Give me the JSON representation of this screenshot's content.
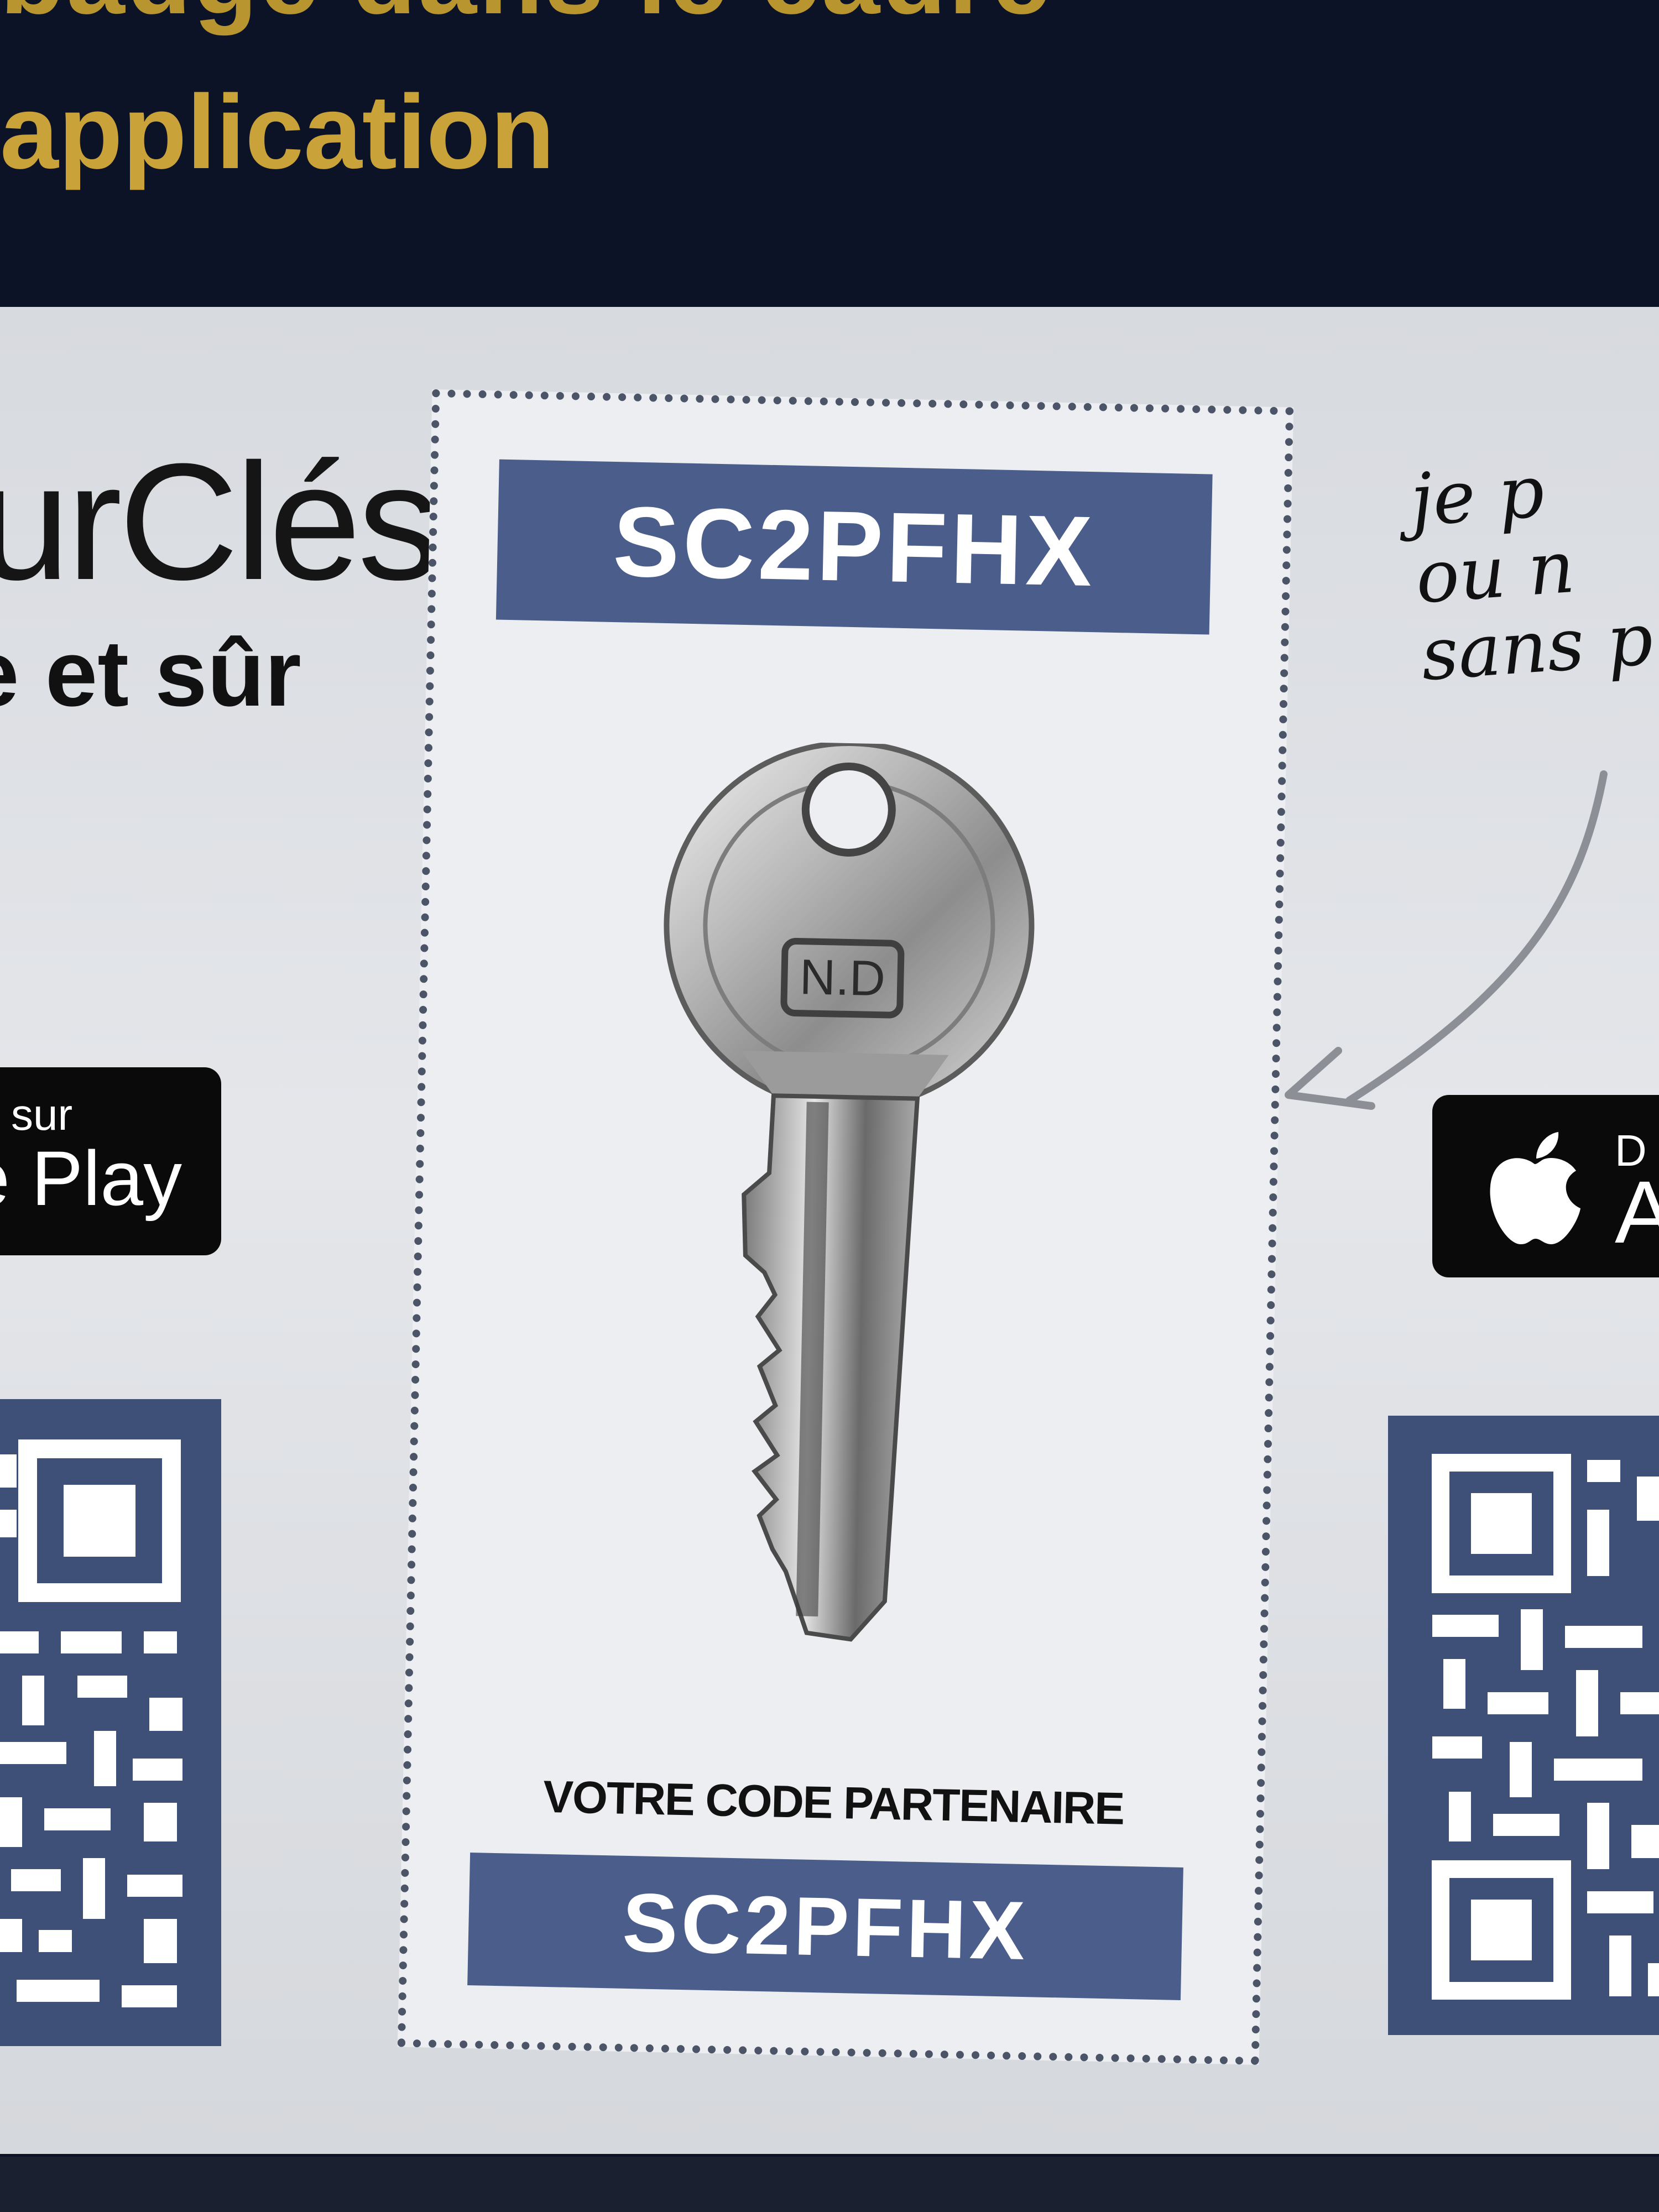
{
  "header": {
    "line1": "badge dans le cadre",
    "line2": "application"
  },
  "brand": {
    "name": "urClés",
    "tagline": "e et sûr"
  },
  "handwriting": {
    "text": "je p\nou n\nsans p"
  },
  "stores": {
    "google_small": "sur",
    "google_big": "e Play",
    "apple_small": "D",
    "apple_big": "A"
  },
  "coupon": {
    "code_top": "SC2PFHX",
    "label": "VOTRE CODE PARTENAIRE",
    "code_bottom": "SC2PFHX",
    "key_stamp": "N.D"
  },
  "colors": {
    "background_dark": "#0d1326",
    "headline_gold": "#c9a23a",
    "code_bar_blue": "#4b5e8b",
    "qr_blue": "#3e5077"
  }
}
